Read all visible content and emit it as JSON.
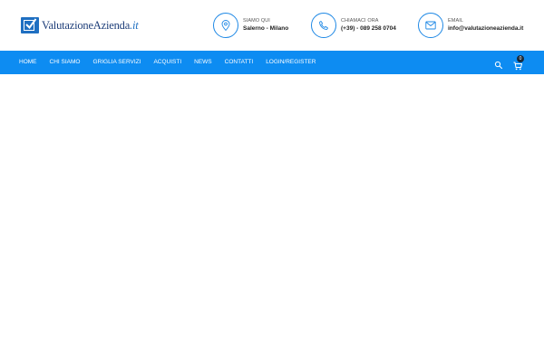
{
  "logo": {
    "name": "ValutazioneAzienda",
    "tld": ".it"
  },
  "contacts": [
    {
      "label": "SIAMO QUI",
      "value": "Salerno - Milano",
      "icon": "location-pin-icon"
    },
    {
      "label": "CHIAMACI ORA",
      "value": "(+39) - 089 258 0704",
      "icon": "phone-icon"
    },
    {
      "label": "EMAIL",
      "value": "info@valutazioneazienda.it",
      "icon": "envelope-icon"
    }
  ],
  "nav": {
    "items": [
      {
        "label": "HOME"
      },
      {
        "label": "CHI SIAMO"
      },
      {
        "label": "GRIGLIA SERVIZI"
      },
      {
        "label": "ACQUISTI"
      },
      {
        "label": "NEWS"
      },
      {
        "label": "CONTATTI"
      },
      {
        "label": "LOGIN/REGISTER"
      }
    ],
    "cart_count": "0",
    "search_icon": "search-icon",
    "cart_icon": "cart-icon"
  },
  "colors": {
    "nav_bg": "#0d8cf2",
    "accent": "#1e88e5",
    "logo_blue": "#1f6fc1"
  }
}
